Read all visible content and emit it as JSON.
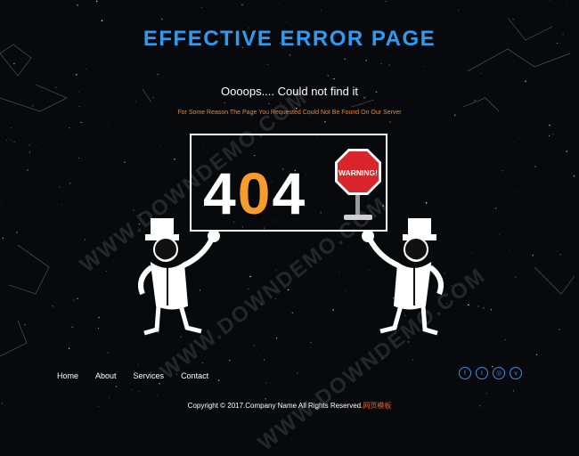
{
  "colors": {
    "title": "#2f9bf0",
    "highlight_orange": "#f59c2c",
    "message_orange": "#e8862b",
    "social_blue": "#3b8ede",
    "warning_red": "#d8262c"
  },
  "header": {
    "title": "EFFECTIVE ERROR PAGE",
    "subtitle": "Oooops.... Could not find it",
    "message": "For Some Reason The Page You Requested Could Not Be Found On Our Server"
  },
  "error_board": {
    "digit_1": "4",
    "digit_2": "0",
    "digit_3": "4",
    "sign_text": "WARNING!"
  },
  "nav": {
    "items": [
      {
        "label": "Home"
      },
      {
        "label": "About"
      },
      {
        "label": "Services"
      },
      {
        "label": "Contact"
      }
    ]
  },
  "social": {
    "icons": [
      {
        "name": "facebook-icon",
        "glyph": "f"
      },
      {
        "name": "twitter-icon",
        "glyph": "t"
      },
      {
        "name": "instagram-icon",
        "glyph": "◎"
      },
      {
        "name": "vimeo-icon",
        "glyph": "v"
      }
    ]
  },
  "footer": {
    "copyright": "Copyright © 2017.Company Name All Rights Reserved.",
    "highlight": "网页模板"
  },
  "watermark": {
    "text": "WWW.DOWNDEMO.COM"
  }
}
